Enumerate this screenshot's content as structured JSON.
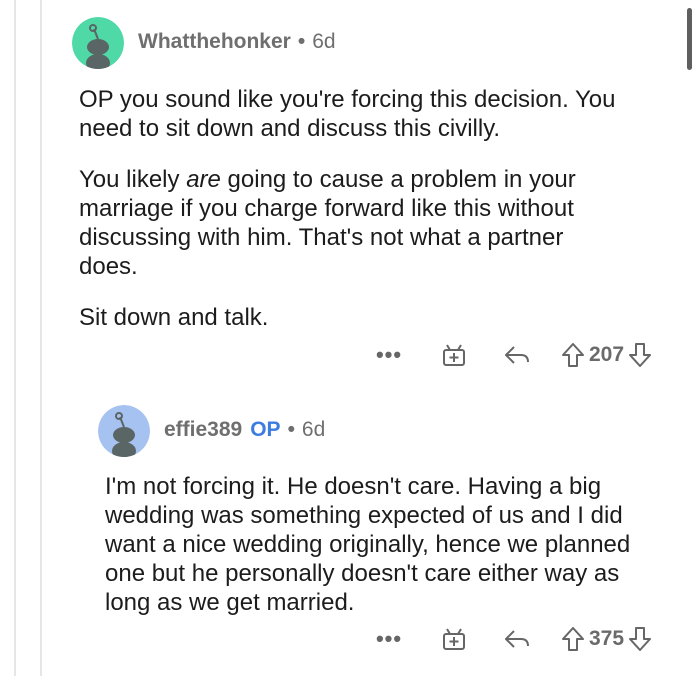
{
  "comments": [
    {
      "username": "Whatthehonker",
      "separator": "•",
      "age": "6d",
      "op_label": "",
      "paragraph_1_line_1": "OP you sound like you're forcing this decision.  You",
      "paragraph_1_line_2": "need to sit down and discuss this civilly.",
      "paragraph_2_prefix": "You likely ",
      "paragraph_2_emphasis": "are",
      "paragraph_2_suffix": " going to cause a problem in your",
      "paragraph_2_line_2": "marriage if you charge forward like this without",
      "paragraph_2_line_3": "discussing with him.   That's not what a partner",
      "paragraph_2_line_4": "does.",
      "paragraph_3": "Sit down and talk.",
      "more_label": "•••",
      "score": "207",
      "avatar_color": "#4fd9a6"
    },
    {
      "username": "effie389",
      "separator": "•",
      "age": "6d",
      "op_label": "OP",
      "line_1": "I'm not forcing it. He doesn't care. Having a big",
      "line_2": "wedding was something expected of us and I did",
      "line_3": "want a nice wedding originally, hence we planned",
      "line_4": "one but he personally doesn't care either way as",
      "line_5": "long as we get married.",
      "more_label": "•••",
      "score": "375",
      "avatar_color": "#a6c2f0"
    }
  ],
  "colors": {
    "op_accent": "#3d7de0",
    "meta_gray": "#6f6f6f",
    "text": "#1c1c1c"
  }
}
